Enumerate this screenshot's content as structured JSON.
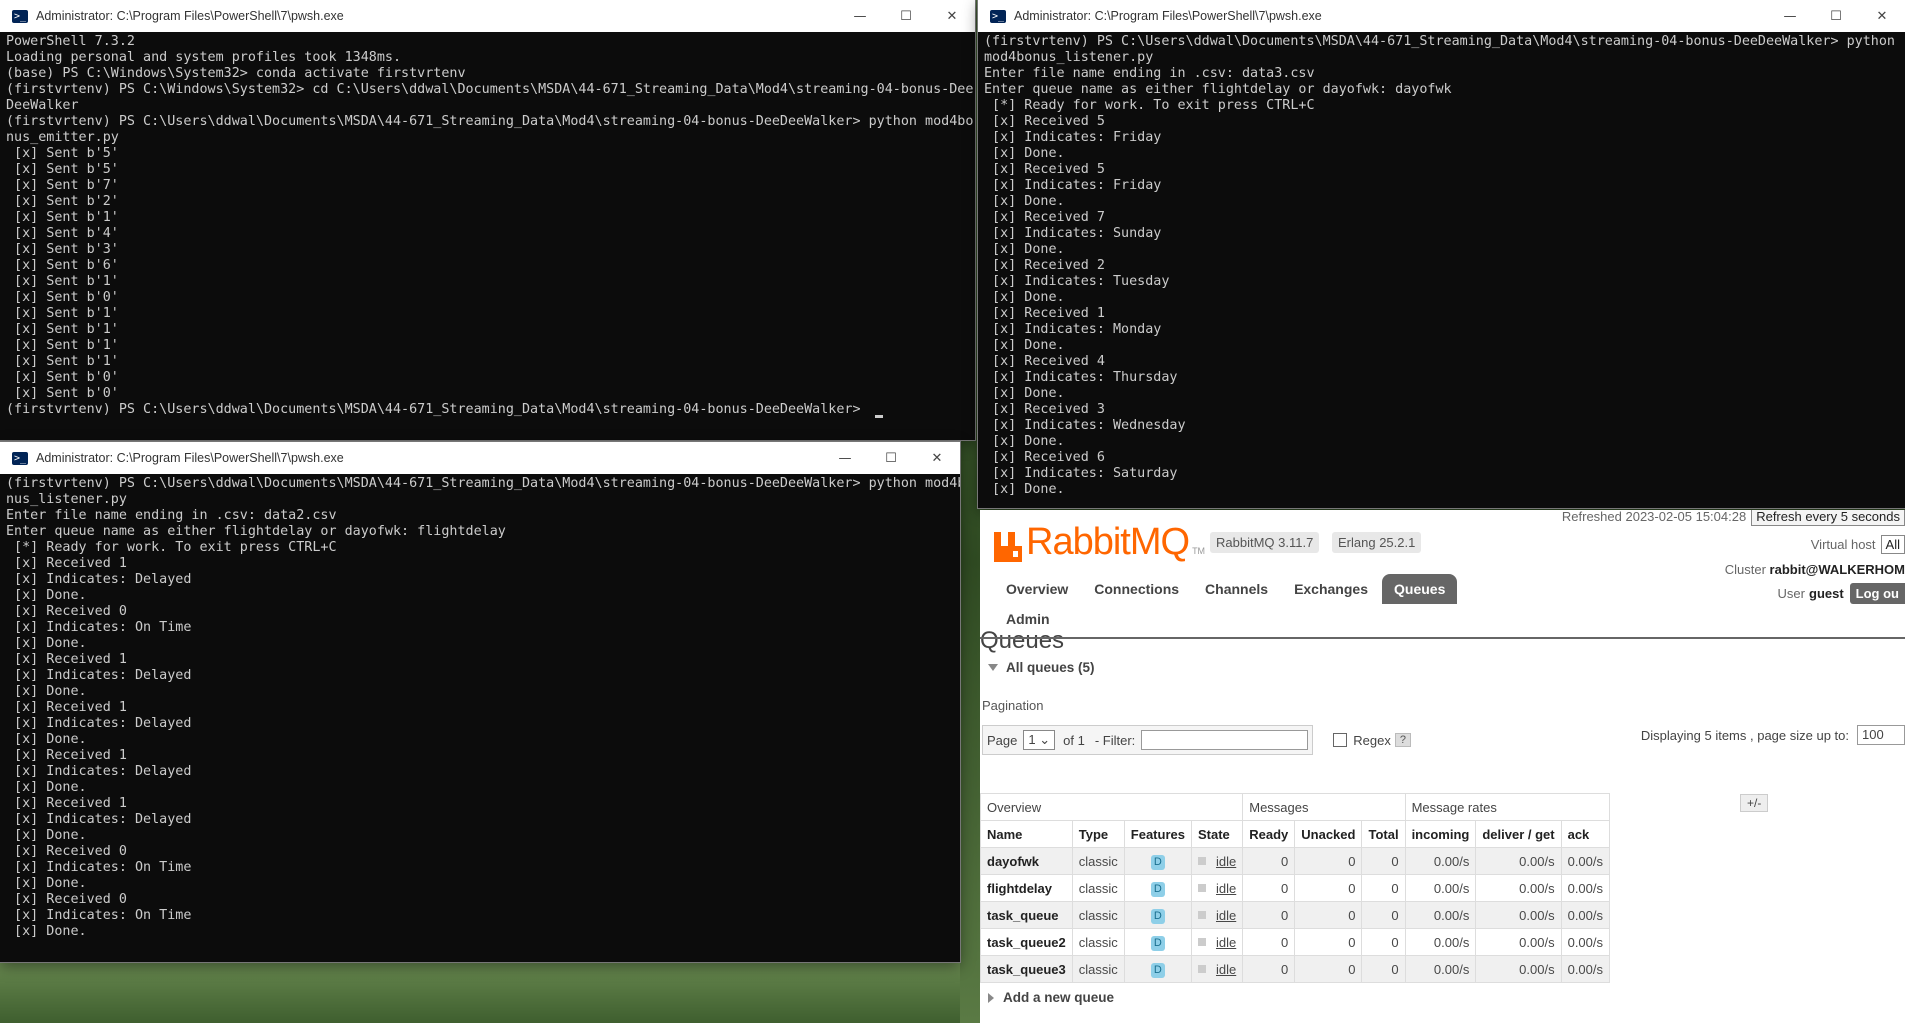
{
  "top_left_window": {
    "title": "Administrator: C:\\Program Files\\PowerShell\\7\\pwsh.exe",
    "lines": [
      "PowerShell 7.3.2",
      "Loading personal and system profiles took 1348ms.",
      "(base) PS C:\\Windows\\System32> conda activate firstvrtenv",
      "(firstvrtenv) PS C:\\Windows\\System32> cd C:\\Users\\ddwal\\Documents\\MSDA\\44-671_Streaming_Data\\Mod4\\streaming-04-bonus-Dee",
      "DeeWalker",
      "(firstvrtenv) PS C:\\Users\\ddwal\\Documents\\MSDA\\44-671_Streaming_Data\\Mod4\\streaming-04-bonus-DeeDeeWalker> python mod4bo",
      "nus_emitter.py",
      " [x] Sent b'5'",
      " [x] Sent b'5'",
      " [x] Sent b'7'",
      " [x] Sent b'2'",
      " [x] Sent b'1'",
      " [x] Sent b'4'",
      " [x] Sent b'3'",
      " [x] Sent b'6'",
      " [x] Sent b'1'",
      " [x] Sent b'0'",
      " [x] Sent b'1'",
      " [x] Sent b'1'",
      " [x] Sent b'1'",
      " [x] Sent b'1'",
      " [x] Sent b'0'",
      " [x] Sent b'0'",
      "(firstvrtenv) PS C:\\Users\\ddwal\\Documents\\MSDA\\44-671_Streaming_Data\\Mod4\\streaming-04-bonus-DeeDeeWalker> "
    ]
  },
  "bottom_left_window": {
    "title": "Administrator: C:\\Program Files\\PowerShell\\7\\pwsh.exe",
    "lines": [
      "(firstvrtenv) PS C:\\Users\\ddwal\\Documents\\MSDA\\44-671_Streaming_Data\\Mod4\\streaming-04-bonus-DeeDeeWalker> python mod4bo",
      "nus_listener.py",
      "Enter file name ending in .csv: data2.csv",
      "Enter queue name as either flightdelay or dayofwk: flightdelay",
      " [*] Ready for work. To exit press CTRL+C",
      " [x] Received 1",
      " [x] Indicates: Delayed",
      " [x] Done.",
      " [x] Received 0",
      " [x] Indicates: On Time",
      " [x] Done.",
      " [x] Received 1",
      " [x] Indicates: Delayed",
      " [x] Done.",
      " [x] Received 1",
      " [x] Indicates: Delayed",
      " [x] Done.",
      " [x] Received 1",
      " [x] Indicates: Delayed",
      " [x] Done.",
      " [x] Received 1",
      " [x] Indicates: Delayed",
      " [x] Done.",
      " [x] Received 0",
      " [x] Indicates: On Time",
      " [x] Done.",
      " [x] Received 0",
      " [x] Indicates: On Time",
      " [x] Done."
    ]
  },
  "right_window": {
    "title": "Administrator: C:\\Program Files\\PowerShell\\7\\pwsh.exe",
    "lines": [
      "(firstvrtenv) PS C:\\Users\\ddwal\\Documents\\MSDA\\44-671_Streaming_Data\\Mod4\\streaming-04-bonus-DeeDeeWalker> python",
      "mod4bonus_listener.py",
      "Enter file name ending in .csv: data3.csv",
      "Enter queue name as either flightdelay or dayofwk: dayofwk",
      " [*] Ready for work. To exit press CTRL+C",
      " [x] Received 5",
      " [x] Indicates: Friday",
      " [x] Done.",
      " [x] Received 5",
      " [x] Indicates: Friday",
      " [x] Done.",
      " [x] Received 7",
      " [x] Indicates: Sunday",
      " [x] Done.",
      " [x] Received 2",
      " [x] Indicates: Tuesday",
      " [x] Done.",
      " [x] Received 1",
      " [x] Indicates: Monday",
      " [x] Done.",
      " [x] Received 4",
      " [x] Indicates: Thursday",
      " [x] Done.",
      " [x] Received 3",
      " [x] Indicates: Wednesday",
      " [x] Done.",
      " [x] Received 6",
      " [x] Indicates: Saturday",
      " [x] Done."
    ]
  },
  "window_buttons": {
    "minimize": "—",
    "maximize": "☐",
    "close": "✕"
  },
  "rabbitmq": {
    "logo_text": "RabbitMQ",
    "logo_tm": "TM",
    "version": "RabbitMQ 3.11.7",
    "erlang": "Erlang 25.2.1",
    "refreshed": "Refreshed 2023-02-05 15:04:28",
    "refresh_option": "Refresh every 5 seconds",
    "virtual_host_label": "Virtual host",
    "virtual_host_value": "All",
    "cluster_label": "Cluster",
    "cluster_value": "rabbit@WALKERHOM",
    "user_label": "User",
    "user_value": "guest",
    "logout": "Log ou",
    "nav": [
      "Overview",
      "Connections",
      "Channels",
      "Exchanges",
      "Queues",
      "Admin"
    ],
    "active_nav": "Queues",
    "page_title": "Queues",
    "all_queues": "All queues (5)",
    "pagination_label": "Pagination",
    "page_label": "Page",
    "page_value": "1",
    "of_label": "of 1",
    "filter_label": "- Filter:",
    "regex_label": "Regex",
    "help": "?",
    "displaying": "Displaying 5 items , page size up to:",
    "page_size": "100",
    "plus_minus": "+/-",
    "add_queue": "Add a new queue",
    "table": {
      "group_headers": [
        "Overview",
        "Messages",
        "Message rates"
      ],
      "columns": [
        "Name",
        "Type",
        "Features",
        "State",
        "Ready",
        "Unacked",
        "Total",
        "incoming",
        "deliver / get",
        "ack"
      ],
      "rows": [
        [
          "dayofwk",
          "classic",
          "D",
          "idle",
          "0",
          "0",
          "0",
          "0.00/s",
          "0.00/s",
          "0.00/s"
        ],
        [
          "flightdelay",
          "classic",
          "D",
          "idle",
          "0",
          "0",
          "0",
          "0.00/s",
          "0.00/s",
          "0.00/s"
        ],
        [
          "task_queue",
          "classic",
          "D",
          "idle",
          "0",
          "0",
          "0",
          "0.00/s",
          "0.00/s",
          "0.00/s"
        ],
        [
          "task_queue2",
          "classic",
          "D",
          "idle",
          "0",
          "0",
          "0",
          "0.00/s",
          "0.00/s",
          "0.00/s"
        ],
        [
          "task_queue3",
          "classic",
          "D",
          "idle",
          "0",
          "0",
          "0",
          "0.00/s",
          "0.00/s",
          "0.00/s"
        ]
      ]
    }
  }
}
